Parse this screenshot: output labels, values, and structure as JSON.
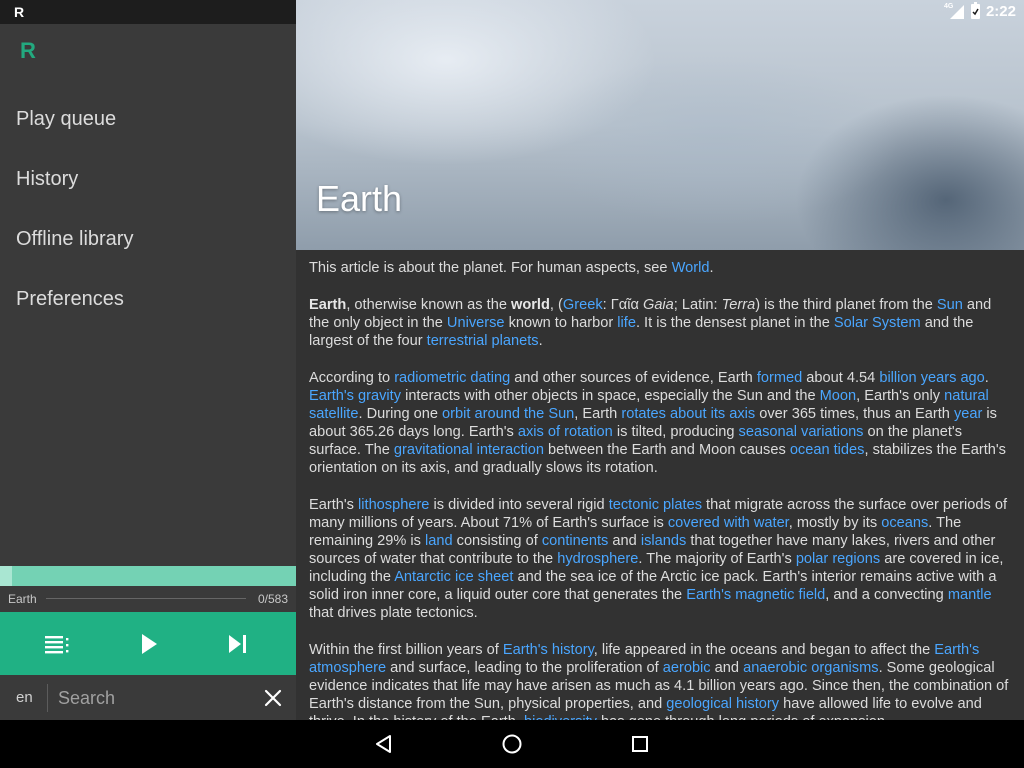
{
  "status_bar": {
    "notification": "R",
    "network": "4G",
    "time": "2:22"
  },
  "drawer": {
    "logo": "R",
    "menu": [
      "Play queue",
      "History",
      "Offline library",
      "Preferences"
    ],
    "player": {
      "title": "Earth",
      "position": "0/583",
      "progress": 0.04
    },
    "search": {
      "language": "en",
      "placeholder": "Search",
      "value": ""
    }
  },
  "article": {
    "title": "Earth",
    "hatnote": {
      "text": "This article is about the planet. For human aspects, see ",
      "link": "World",
      "end": "."
    },
    "p1": [
      {
        "b": "Earth"
      },
      {
        "t": ", otherwise known as the "
      },
      {
        "b": "world"
      },
      {
        "t": ", ("
      },
      {
        "a": "Greek"
      },
      {
        "t": ": Γαῖα "
      },
      {
        "i": "Gaia"
      },
      {
        "t": "; Latin: "
      },
      {
        "i": "Terra"
      },
      {
        "t": ") is the third planet from the "
      },
      {
        "a": "Sun"
      },
      {
        "t": " and the only object in the "
      },
      {
        "a": "Universe"
      },
      {
        "t": " known to harbor "
      },
      {
        "a": "life"
      },
      {
        "t": ". It is the densest planet in the "
      },
      {
        "a": "Solar System"
      },
      {
        "t": " and the largest of the four "
      },
      {
        "a": "terrestrial planets"
      },
      {
        "t": "."
      }
    ],
    "p2": [
      {
        "t": "According to "
      },
      {
        "a": "radiometric dating"
      },
      {
        "t": " and other sources of evidence, Earth "
      },
      {
        "a": "formed"
      },
      {
        "t": " about 4.54 "
      },
      {
        "a": "billion years ago"
      },
      {
        "t": ". "
      },
      {
        "a": "Earth's gravity"
      },
      {
        "t": " interacts with other objects in space, especially the Sun and the "
      },
      {
        "a": "Moon"
      },
      {
        "t": ", Earth's only "
      },
      {
        "a": "natural satellite"
      },
      {
        "t": ". During one "
      },
      {
        "a": "orbit around the Sun"
      },
      {
        "t": ", Earth "
      },
      {
        "a": "rotates about its axis"
      },
      {
        "t": " over 365 times, thus an Earth "
      },
      {
        "a": "year"
      },
      {
        "t": " is about 365.26 days long. Earth's "
      },
      {
        "a": "axis of rotation"
      },
      {
        "t": " is tilted, producing "
      },
      {
        "a": "seasonal variations"
      },
      {
        "t": " on the planet's surface. The "
      },
      {
        "a": "gravitational interaction"
      },
      {
        "t": " between the Earth and Moon causes "
      },
      {
        "a": "ocean tides"
      },
      {
        "t": ", stabilizes the Earth's orientation on its axis, and gradually slows its rotation."
      }
    ],
    "p3": [
      {
        "t": "Earth's "
      },
      {
        "a": "lithosphere"
      },
      {
        "t": " is divided into several rigid "
      },
      {
        "a": "tectonic plates"
      },
      {
        "t": " that migrate across the surface over periods of many millions of years. About 71% of Earth's surface is "
      },
      {
        "a": "covered with water"
      },
      {
        "t": ", mostly by its "
      },
      {
        "a": "oceans"
      },
      {
        "t": ". The remaining 29% is "
      },
      {
        "a": "land"
      },
      {
        "t": " consisting of "
      },
      {
        "a": "continents"
      },
      {
        "t": " and "
      },
      {
        "a": "islands"
      },
      {
        "t": " that together have many lakes, rivers and other sources of water that contribute to the "
      },
      {
        "a": "hydrosphere"
      },
      {
        "t": ". The majority of Earth's "
      },
      {
        "a": "polar regions"
      },
      {
        "t": " are covered in ice, including the "
      },
      {
        "a": "Antarctic ice sheet"
      },
      {
        "t": " and the sea ice of the Arctic ice pack. Earth's interior remains active with a solid iron inner core, a liquid outer core that generates the "
      },
      {
        "a": "Earth's magnetic field"
      },
      {
        "t": ", and a convecting "
      },
      {
        "a": "mantle"
      },
      {
        "t": " that drives plate tectonics."
      }
    ],
    "p4": [
      {
        "t": "Within the first billion years of "
      },
      {
        "a": "Earth's history"
      },
      {
        "t": ", life appeared in the oceans and began to affect the "
      },
      {
        "a": "Earth's atmosphere"
      },
      {
        "t": " and surface, leading to the proliferation of "
      },
      {
        "a": "aerobic"
      },
      {
        "t": " and "
      },
      {
        "a": "anaerobic organisms"
      },
      {
        "t": ". Some geological evidence indicates that life may have arisen as much as 4.1 billion years ago. Since then, the combination of Earth's distance from the Sun, physical properties, and "
      },
      {
        "a": "geological history"
      },
      {
        "t": " have allowed life to evolve and thrive. In the history of the Earth, "
      },
      {
        "a": "biodiversity"
      },
      {
        "t": " has gone through long periods of expansion."
      }
    ]
  },
  "colors": {
    "accent": "#20b184",
    "link": "#4aa6ff",
    "background": "#323232",
    "drawer": "#3a3a3a"
  }
}
